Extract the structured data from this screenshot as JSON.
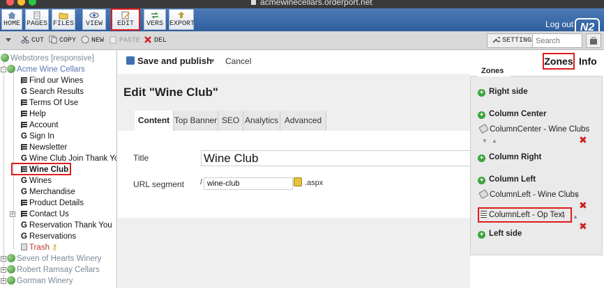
{
  "window": {
    "url": "acmewinecellars.orderport.net"
  },
  "toolbar": {
    "buttons": [
      {
        "label": "HOME",
        "icon": "home-icon"
      },
      {
        "label": "PAGES",
        "icon": "pages-icon"
      },
      {
        "label": "FILES",
        "icon": "folder-icon"
      },
      {
        "label": "VIEW",
        "icon": "eye-icon"
      },
      {
        "label": "EDIT",
        "icon": "edit-icon"
      },
      {
        "label": "VERS",
        "icon": "versions-icon"
      },
      {
        "label": "EXPORT",
        "icon": "export-icon"
      }
    ],
    "logout": "Log out",
    "logo": "N2"
  },
  "subtoolbar": {
    "cut": "CUT",
    "copy": "COPY",
    "new": "NEW",
    "paste": "PASTE",
    "del": "DEL",
    "settings": "SETTINGS",
    "search_placeholder": "Search"
  },
  "tree": {
    "root": "Webstores [responsive]",
    "site": "Acme Wine Cellars",
    "items": [
      {
        "label": "Find our Wines",
        "type": "page"
      },
      {
        "label": "Search Results",
        "type": "g"
      },
      {
        "label": "Terms Of Use",
        "type": "page"
      },
      {
        "label": "Help",
        "type": "page"
      },
      {
        "label": "Account",
        "type": "page"
      },
      {
        "label": "Sign In",
        "type": "g"
      },
      {
        "label": "Newsletter",
        "type": "page"
      },
      {
        "label": "Wine Club Join Thank You",
        "type": "g"
      },
      {
        "label": "Wine Club",
        "type": "page"
      },
      {
        "label": "Wines",
        "type": "g"
      },
      {
        "label": "Merchandise",
        "type": "g"
      },
      {
        "label": "Product Details",
        "type": "page"
      },
      {
        "label": "Contact Us",
        "type": "page"
      },
      {
        "label": "Reservation Thank You",
        "type": "g"
      },
      {
        "label": "Reservations",
        "type": "g"
      }
    ],
    "trash": "Trash",
    "other_sites": [
      "Seven of Hearts Winery",
      "Robert Ramsay Cellars",
      "Gorman Winery"
    ]
  },
  "editor": {
    "save_publish": "Save and publish",
    "cancel": "Cancel",
    "title": "Edit \"Wine Club\"",
    "tabs": [
      "Content",
      "Top Banner",
      "SEO",
      "Analytics",
      "Advanced"
    ],
    "active_tab": "Content",
    "fields": {
      "title_label": "Title",
      "title_value": "Wine Club",
      "url_label": "URL segment",
      "url_prefix": "/",
      "url_value": "wine-club",
      "url_suffix": ".aspx"
    }
  },
  "zones": {
    "zones_link": "Zones",
    "info_link": "Info",
    "panel_tab": "Zones",
    "rows": [
      {
        "label": "Right side",
        "kind": "zone"
      },
      {
        "label": "Column Center",
        "kind": "zone"
      },
      {
        "label": "ColumnCenter - Wine Clubs",
        "kind": "part"
      },
      {
        "label": "Column Right",
        "kind": "zone"
      },
      {
        "label": "Column Left",
        "kind": "zone"
      },
      {
        "label": "ColumnLeft - Wine Clubs",
        "kind": "part"
      },
      {
        "label": "ColumnLeft - Op Text",
        "kind": "text"
      },
      {
        "label": "Left side",
        "kind": "zone"
      }
    ]
  },
  "colors": {
    "toolbar_blue": "#2f5f9e",
    "highlight_red": "#e01b1b",
    "add_green": "#3aa33a"
  }
}
